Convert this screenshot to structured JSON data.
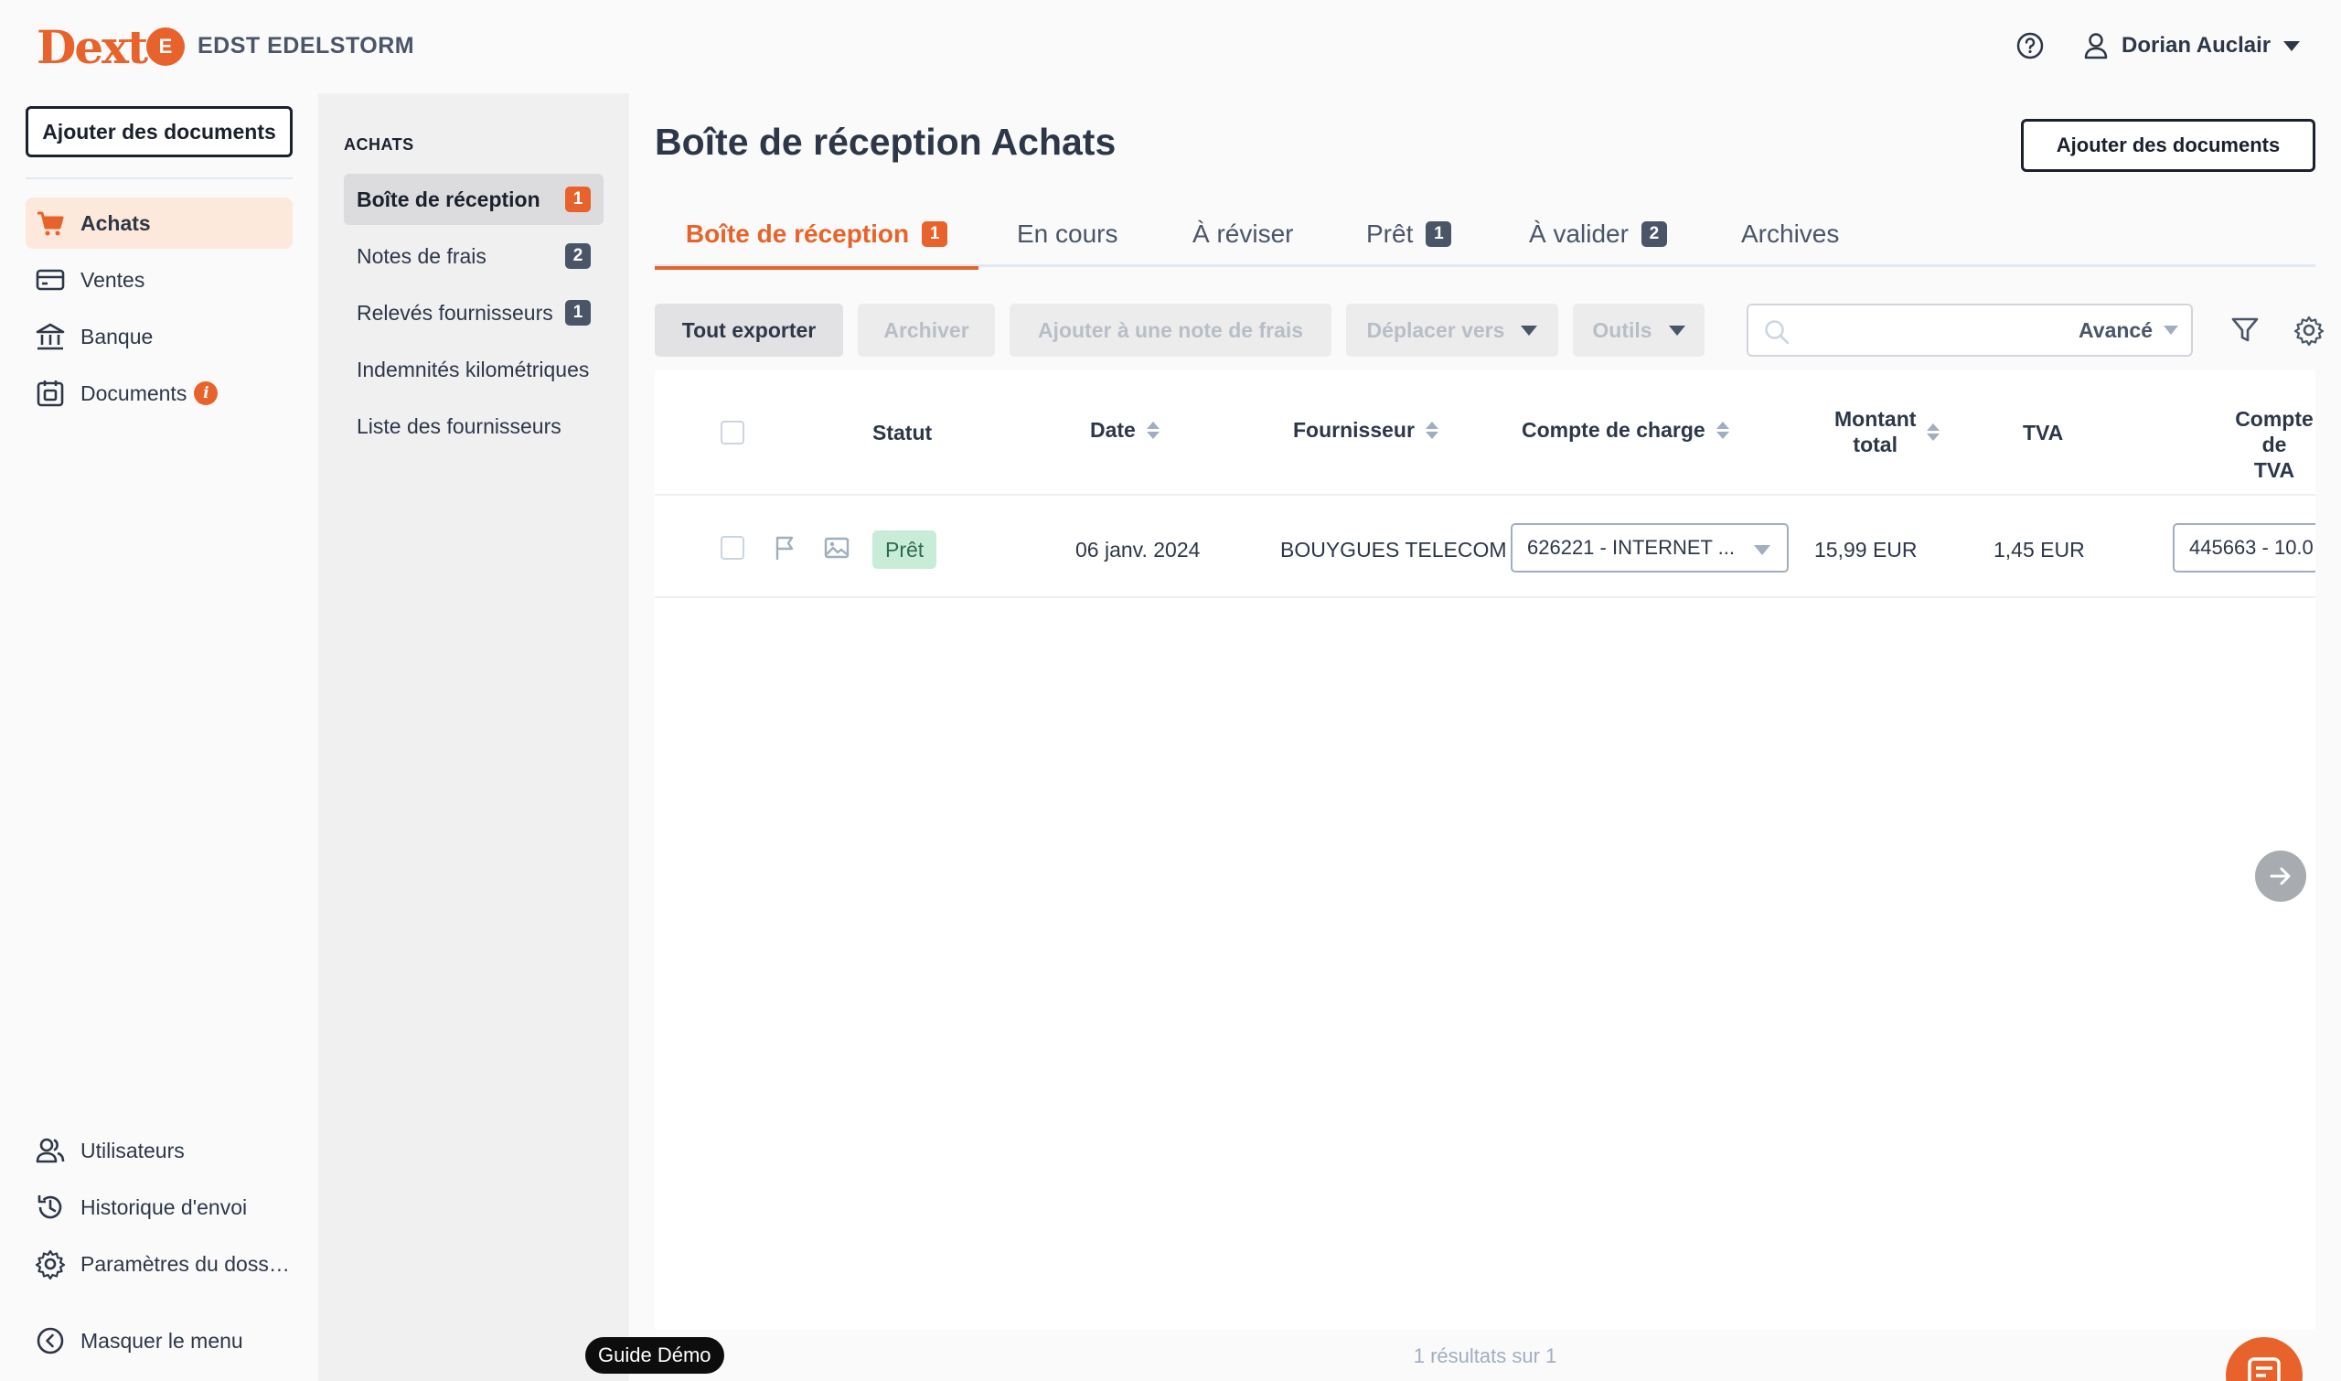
{
  "brand": {
    "logo": "Dext",
    "company_initial": "E",
    "company_name": "EDST EDELSTORM",
    "accent": "#e8632b"
  },
  "header": {
    "user_name": "Dorian Auclair",
    "help_icon": "help-circle-icon",
    "user_icon": "user-icon"
  },
  "sidebar": {
    "add_documents": "Ajouter des documents",
    "items": [
      {
        "label": "Achats",
        "icon": "cart-icon",
        "active": true
      },
      {
        "label": "Ventes",
        "icon": "wallet-icon"
      },
      {
        "label": "Banque",
        "icon": "bank-icon"
      },
      {
        "label": "Documents",
        "icon": "document-icon",
        "info": "i"
      }
    ],
    "bottom_items": [
      {
        "label": "Utilisateurs",
        "icon": "users-icon"
      },
      {
        "label": "Historique d'envoi",
        "icon": "history-icon"
      },
      {
        "label": "Paramètres du doss…",
        "icon": "gear-icon"
      }
    ],
    "collapse": "Masquer le menu"
  },
  "subnav": {
    "title": "ACHATS",
    "items": [
      {
        "label": "Boîte de réception",
        "count": "1",
        "active": true
      },
      {
        "label": "Notes de frais",
        "count": "2"
      },
      {
        "label": "Relevés fournisseurs",
        "count": "1"
      },
      {
        "label": "Indemnités kilométriques"
      },
      {
        "label": "Liste des fournisseurs"
      }
    ]
  },
  "main": {
    "title": "Boîte de réception Achats",
    "add_documents": "Ajouter des documents",
    "tabs": [
      {
        "label": "Boîte de réception",
        "count": "1",
        "active": true
      },
      {
        "label": "En cours"
      },
      {
        "label": "À réviser"
      },
      {
        "label": "Prêt",
        "count": "1"
      },
      {
        "label": "À valider",
        "count": "2"
      },
      {
        "label": "Archives"
      }
    ],
    "toolbar": {
      "export_all": "Tout exporter",
      "archive": "Archiver",
      "add_expense": "Ajouter à une note de frais",
      "move_to": "Déplacer vers",
      "tools": "Outils",
      "search_placeholder": "",
      "advanced": "Avancé"
    },
    "table": {
      "headers": {
        "status": "Statut",
        "date": "Date",
        "supplier": "Fournisseur",
        "expense_account": "Compte de charge",
        "total_line1": "Montant",
        "total_line2": "total",
        "vat": "TVA",
        "vat_account_line1": "Compte de",
        "vat_account_line2": "TVA"
      },
      "rows": [
        {
          "status": "Prêt",
          "date": "06 janv. 2024",
          "supplier": "BOUYGUES TELECOM",
          "expense_account": "626221 - INTERNET ...",
          "total": "15,99 EUR",
          "vat": "1,45 EUR",
          "vat_account": "445663 - 10.0"
        }
      ]
    },
    "results": "1 résultats sur 1"
  },
  "guide_label": "Guide Démo"
}
